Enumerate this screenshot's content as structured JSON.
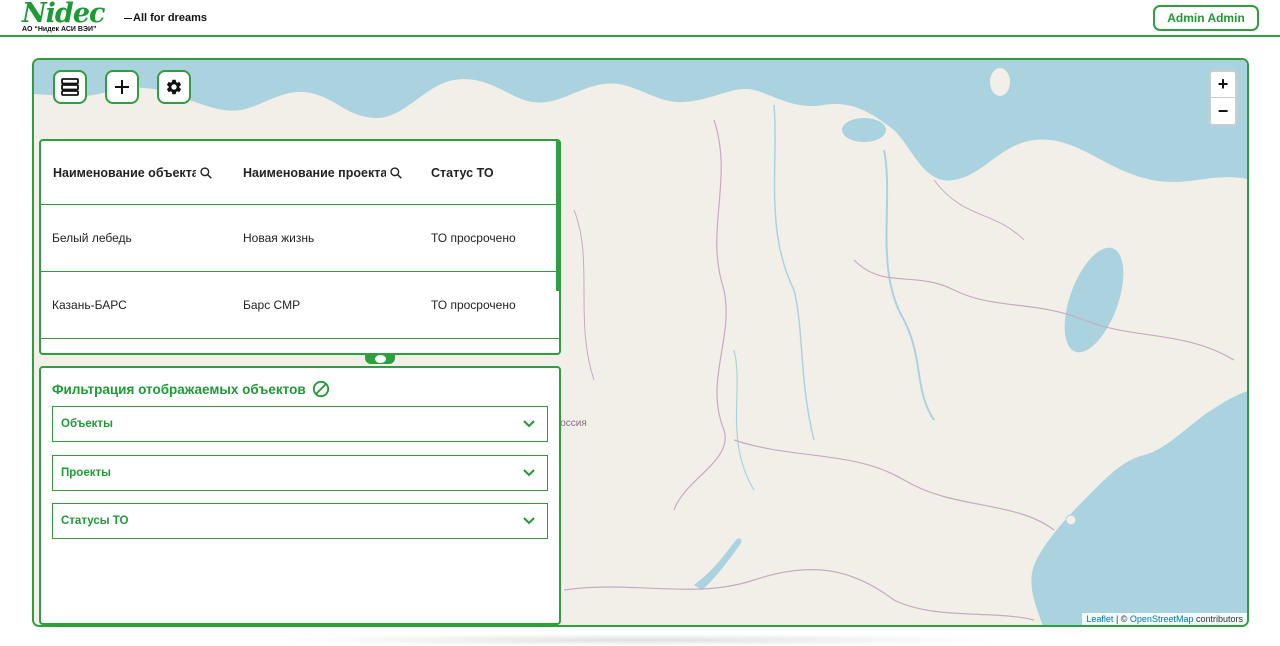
{
  "header": {
    "logo_text": "Nidec",
    "tagline": "All for dreams",
    "company": "АО “Нидек АСИ ВЭИ”",
    "user_label": "Admin Admin"
  },
  "map": {
    "country_label": "Россия",
    "zoom_in": "+",
    "zoom_out": "−",
    "attribution": {
      "leaflet": "Leaflet",
      "sep": " | © ",
      "osm": "OpenStreetMap",
      "contributors": " contributors"
    }
  },
  "toolbar": {
    "list_icon": "server-list-icon",
    "add_icon": "plus-icon",
    "settings_icon": "gear-icon"
  },
  "table": {
    "columns": [
      {
        "label": "Наименование объекта",
        "icon": "search-icon"
      },
      {
        "label": "Наименование проекта",
        "icon": "search-icon"
      },
      {
        "label": "Статус ТО"
      }
    ],
    "rows": [
      {
        "object": "Белый лебедь",
        "project": "Новая жизнь",
        "status": "ТО просрочено"
      },
      {
        "object": "Казань-БАРС",
        "project": "Барс СМР",
        "status": "ТО просрочено"
      }
    ]
  },
  "filter": {
    "title": "Фильтрация отображаемых объектов",
    "clear_icon": "block-icon",
    "sections": [
      {
        "label": "Объекты"
      },
      {
        "label": "Проекты"
      },
      {
        "label": "Статусы ТО"
      }
    ]
  },
  "colors": {
    "accent": "#2e9e3e",
    "water": "#aad3df",
    "land": "#f2efe9",
    "border": "#c8a9c4"
  }
}
